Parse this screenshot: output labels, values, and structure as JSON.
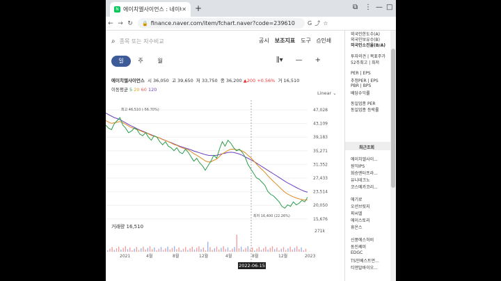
{
  "browser": {
    "tab_title": "에이치엘사이언스 : 네이버 증권",
    "url": "finance.naver.com/item/fchart.naver?code=239610"
  },
  "search": {
    "placeholder": "종목 또는 지수비교"
  },
  "toplinks": [
    "공시",
    "보조지표",
    "도구",
    "인쇄"
  ],
  "periods": [
    "일",
    "주",
    "월"
  ],
  "stock": {
    "name": "에이치엘사이언스",
    "open_label": "시",
    "open": "36,050",
    "high_label": "고",
    "high": "39,650",
    "low_label": "저",
    "low": "33,750",
    "close_label": "종",
    "close": "36,200",
    "change": "▲200 +0.56%",
    "vol_label": "거",
    "volume": "16,510"
  },
  "ma": {
    "label": "이동평균",
    "p5": "5",
    "p20": "20",
    "p60": "60",
    "p120": "120"
  },
  "scale_mode": "Linear",
  "volume_label": "거래량 16,510",
  "selected_date": "2022-06-15",
  "chart_data": {
    "type": "line",
    "y_ticks": [
      "47,028",
      "43,109",
      "39,183",
      "35,271",
      "31,352",
      "27,433",
      "23,514",
      "20,050",
      "15,676"
    ],
    "x_ticks": [
      "2021",
      "4월",
      "8월",
      "12월",
      "4월",
      "8월",
      "12월",
      "2023"
    ],
    "volume_tick": "271k",
    "max_annotation": "최고 46,510 (-56.70%)",
    "min_annotation": "최저 16,400 (22.26%)",
    "ylim": [
      13000,
      50000
    ],
    "price": [
      44000,
      43000,
      42500,
      44500,
      45500,
      46510,
      44000,
      43000,
      41500,
      42000,
      43000,
      42500,
      41000,
      40500,
      41500,
      40000,
      39000,
      40500,
      40000,
      38500,
      37500,
      38500,
      37000,
      36500,
      35500,
      36500,
      35000,
      34500,
      36000,
      35000,
      33500,
      32000,
      33000,
      31500,
      30500,
      29000,
      30500,
      32000,
      34000,
      33000,
      36000,
      38500,
      37000,
      39000,
      38000,
      36500,
      35500,
      36000,
      35000,
      33500,
      31000,
      29500,
      28000,
      26500,
      26000,
      25000,
      24000,
      22000,
      21000,
      20500,
      19500,
      18500,
      17000,
      16400,
      17500,
      17000,
      18500,
      17500,
      18000,
      19000,
      18500,
      20050
    ],
    "ma120": [
      48000,
      47500,
      47000,
      46500,
      46200,
      45800,
      45300,
      44800,
      44200,
      43700,
      43300,
      42800,
      42400,
      42000,
      41600,
      41200,
      40800,
      40400,
      40000,
      39700,
      39300,
      38900,
      38500,
      38200,
      37800,
      37400,
      37000,
      36700,
      36400,
      36100,
      35800,
      35400,
      35100,
      34800,
      34500,
      34200,
      34000,
      33900,
      33900,
      34000,
      34200,
      34500,
      34700,
      34900,
      35000,
      34900,
      34700,
      34400,
      34000,
      33500,
      33000,
      32500,
      32000,
      31400,
      30800,
      30200,
      29600,
      29000,
      28400,
      27800,
      27200,
      26600,
      26000,
      25400,
      24800,
      24300,
      23800,
      23300,
      22800,
      22400,
      22000,
      21700
    ],
    "ma60": [
      45500,
      45000,
      44600,
      44800,
      45000,
      45200,
      44800,
      44300,
      43700,
      43200,
      42900,
      42600,
      42200,
      41800,
      41500,
      41100,
      40600,
      40300,
      40100,
      39700,
      39200,
      38900,
      38500,
      38100,
      37600,
      37300,
      36800,
      36400,
      36200,
      35800,
      35200,
      34500,
      34000,
      33400,
      32800,
      32100,
      31800,
      31800,
      32300,
      32700,
      33600,
      34500,
      35000,
      35600,
      36000,
      36000,
      35800,
      35700,
      35400,
      34900,
      34000,
      33200,
      32200,
      31100,
      30100,
      29200,
      28300,
      27200,
      26200,
      25300,
      24400,
      23500,
      22600,
      21700,
      21100,
      20600,
      20200,
      19800,
      19500,
      19300,
      19100,
      19200
    ]
  }
}
